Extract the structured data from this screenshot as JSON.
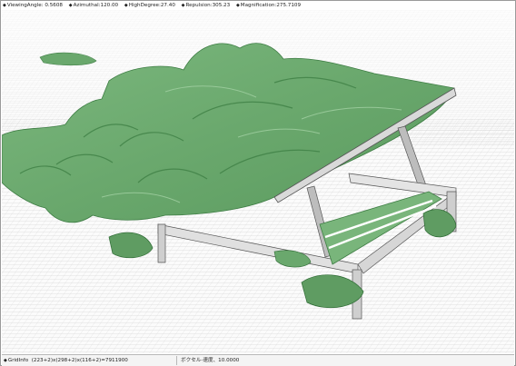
{
  "top_params": [
    {
      "label": "ViewingAngle",
      "value": "0.5608"
    },
    {
      "label": "Azimuthal",
      "value": "120.00"
    },
    {
      "label": "HighDegree",
      "value": "27.40"
    },
    {
      "label": "Repulsion",
      "value": "305.23"
    },
    {
      "label": "Magnification",
      "value": "275.7109"
    }
  ],
  "status": {
    "grid_info_label": "GridInfo",
    "grid_info_value": "(223+2)x(298+2)x(116+2)=7911900",
    "voxel_text": "ボクセル-速度、10.0000"
  },
  "colors": {
    "surface": "#6aa86d",
    "surface_dark": "#3e7d44",
    "grid": "#cfcfcf",
    "frame": "#8a8a8a"
  },
  "icons": {
    "bullet": "diamond-icon"
  }
}
